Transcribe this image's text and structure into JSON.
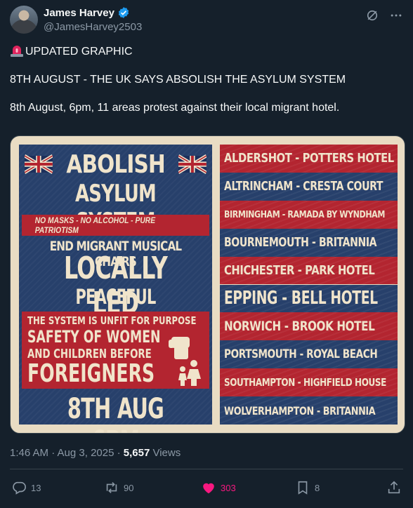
{
  "author": {
    "display_name": "James Harvey",
    "handle": "@JamesHarvey2503"
  },
  "tweet": {
    "line1": "UPDATED GRAPHIC",
    "line2": "8TH AUGUST - THE UK SAYS ABSOLISH THE ASYLUM SYSTEM",
    "line3": "8th August, 6pm, 11 areas protest against their local migrant hotel."
  },
  "poster": {
    "title1": "ABOLISH",
    "title2": "ASYLUM SYSTEM",
    "subtitle": "NO MASKS - NO ALCOHOL - PURE PATRIOTISM",
    "line1": "END MIGRANT MUSICAL CHAIRS",
    "line2": "LOCALLY LED",
    "line3": "PEACEFUL PROTESTS",
    "red_a": "THE SYSTEM IS UNFIT FOR PURPOSE",
    "red_b": "SAFETY OF WOMEN",
    "red_c": "AND CHILDREN BEFORE",
    "red_d": "FOREIGNERS",
    "date": "8TH AUG 6PM",
    "locations": [
      "ALDERSHOT - POTTERS HOTEL",
      "ALTRINCHAM - CRESTA COURT",
      "BIRMINGHAM - RAMADA BY WYNDHAM",
      "BOURNEMOUTH - BRITANNIA",
      "CHICHESTER - PARK HOTEL",
      "EPPING - BELL HOTEL",
      "NORWICH - BROOK HOTEL",
      "PORTSMOUTH - ROYAL BEACH",
      "SOUTHAMPTON - HIGHFIELD HOUSE",
      "WOLVERHAMPTON - BRITANNIA"
    ]
  },
  "meta": {
    "timestamp": "1:46 AM · Aug 3, 2025 · ",
    "views_count": "5,657",
    "views_label": " Views"
  },
  "actions": {
    "replies": "13",
    "reposts": "90",
    "likes": "303",
    "bookmarks": "8"
  },
  "colors": {
    "background": "#15202b",
    "secondary_text": "#8b98a5",
    "like_pink": "#f91880",
    "verified_blue": "#1d9bf0",
    "poster_red": "#b32530",
    "poster_blue": "#27406b",
    "poster_cream": "#f0e4cb"
  }
}
